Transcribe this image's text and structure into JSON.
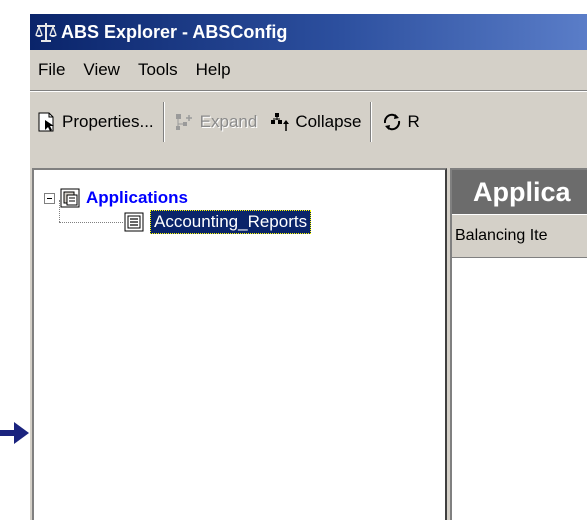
{
  "window": {
    "title": "ABS Explorer - ABSConfig"
  },
  "menu": [
    "File",
    "View",
    "Tools",
    "Help"
  ],
  "toolbar": {
    "properties_label": "Properties...",
    "expand_label": "Expand",
    "collapse_label": "Collapse",
    "refresh_label": "R"
  },
  "tree": {
    "root_label": "Applications",
    "child_label": "Accounting_Reports"
  },
  "right_pane": {
    "header_title": "Applica",
    "column_header": "Balancing Ite"
  },
  "icons": {
    "arrow": "pointer-arrow-icon",
    "app": "scales-icon",
    "properties": "properties-icon",
    "expand": "expand-icon",
    "collapse": "collapse-icon",
    "refresh": "refresh-icon",
    "applications": "applications-folder-icon",
    "report": "report-icon"
  },
  "colors": {
    "title_bar": "#0a246a",
    "selection": "#0a246a",
    "selection_outline": "#ffff00",
    "link_blue": "#0000ff",
    "arrow": "#1a237e",
    "pane_header": "#6c6c6c"
  }
}
